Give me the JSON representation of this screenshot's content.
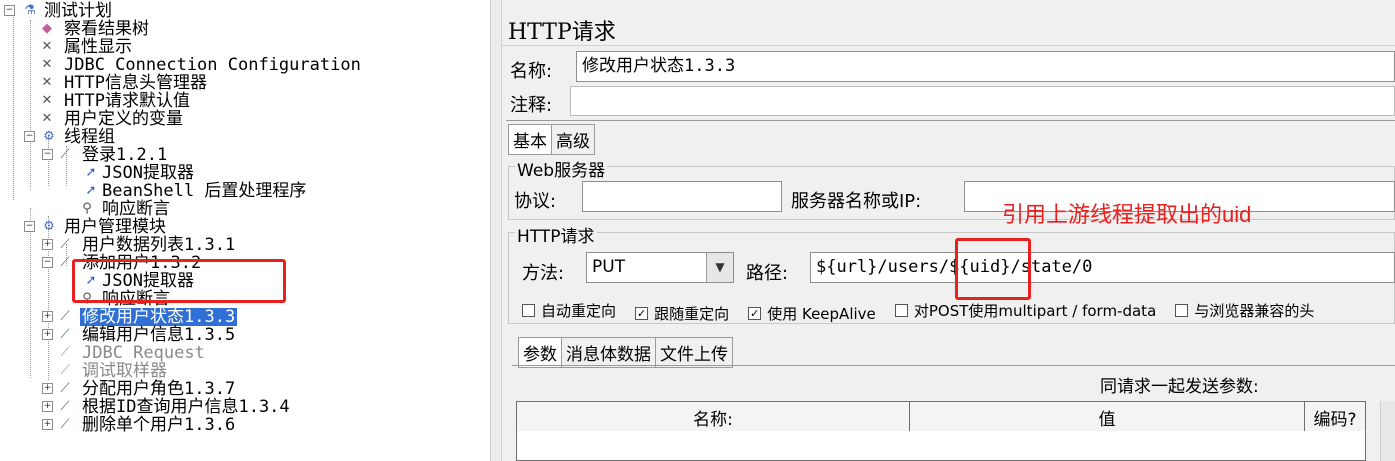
{
  "tree": {
    "root": "测试计划",
    "items": [
      {
        "label": "察看结果树",
        "icon": "result-tree-icon"
      },
      {
        "label": "属性显示",
        "icon": "wrench-icon"
      },
      {
        "label": "JDBC Connection Configuration",
        "icon": "wrench-icon"
      },
      {
        "label": "HTTP信息头管理器",
        "icon": "wrench-icon"
      },
      {
        "label": "HTTP请求默认值",
        "icon": "wrench-icon"
      },
      {
        "label": "用户定义的变量",
        "icon": "wrench-icon"
      },
      {
        "label": "线程组",
        "icon": "gear-icon"
      },
      {
        "label": "登录1.2.1",
        "icon": "pipette-icon"
      },
      {
        "label": "JSON提取器",
        "icon": "extractor-icon"
      },
      {
        "label": "BeanShell 后置处理程序",
        "icon": "extractor-icon"
      },
      {
        "label": "响应断言",
        "icon": "magnifier-icon"
      },
      {
        "label": "用户管理模块",
        "icon": "gear-icon"
      },
      {
        "label": "用户数据列表1.3.1",
        "icon": "pipette-icon"
      },
      {
        "label": "添加用户1.3.2",
        "icon": "pipette-icon"
      },
      {
        "label": "JSON提取器",
        "icon": "extractor-icon"
      },
      {
        "label": "响应断言",
        "icon": "magnifier-icon"
      },
      {
        "label": "修改用户状态1.3.3",
        "icon": "pipette-icon"
      },
      {
        "label": "编辑用户信息1.3.5",
        "icon": "pipette-icon"
      },
      {
        "label": "JDBC Request",
        "icon": "pipette-icon"
      },
      {
        "label": "调试取样器",
        "icon": "pipette-icon"
      },
      {
        "label": "分配用户角色1.3.7",
        "icon": "pipette-icon"
      },
      {
        "label": "根据ID查询用户信息1.3.4",
        "icon": "pipette-icon"
      },
      {
        "label": "删除单个用户1.3.6",
        "icon": "pipette-icon"
      }
    ]
  },
  "panel": {
    "title": "HTTP请求",
    "name_label": "名称:",
    "name_value": "修改用户状态1.3.3",
    "comment_label": "注释:",
    "comment_value": "",
    "tabs": [
      "基本",
      "高级"
    ],
    "web_server_title": "Web服务器",
    "protocol_label": "协议:",
    "protocol_value": "",
    "server_label": "服务器名称或IP:",
    "server_value": "",
    "http_request_title": "HTTP请求",
    "method_label": "方法:",
    "method_value": "PUT",
    "path_label": "路径:",
    "path_prefix": "${url}/users/",
    "path_uid": "${uid}",
    "path_suffix": "/state/0",
    "checkboxes": [
      {
        "label": "自动重定向",
        "checked": false
      },
      {
        "label": "跟随重定向",
        "checked": true
      },
      {
        "label": "使用 KeepAlive",
        "checked": true
      },
      {
        "label": "对POST使用multipart / form-data",
        "checked": false
      },
      {
        "label": "与浏览器兼容的头",
        "checked": false
      }
    ],
    "param_tabs": [
      "参数",
      "消息体数据",
      "文件上传"
    ],
    "send_params_label": "同请求一起发送参数:",
    "table_headers": [
      "名称:",
      "值",
      "编码?"
    ]
  },
  "annotation": "引用上游线程提取出的uid",
  "colors": {
    "highlight_box": "#e8211f",
    "selection": "#2f6fd6"
  }
}
